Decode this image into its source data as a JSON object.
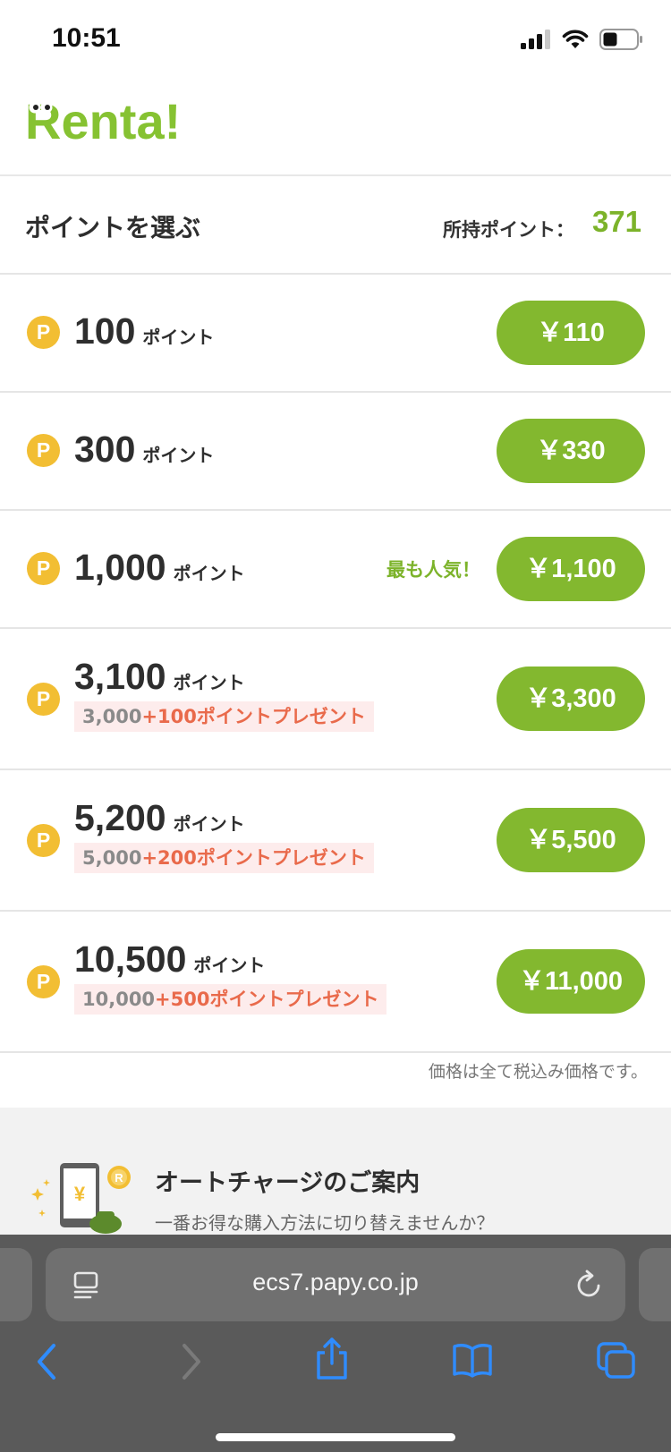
{
  "status_bar": {
    "time": "10:51"
  },
  "header": {
    "logo_text": "Renta!"
  },
  "points_section": {
    "title": "ポイントを選ぶ",
    "owned_label": "所持ポイント：",
    "owned_value": "371"
  },
  "point_options": [
    {
      "amount": "100",
      "unit": "ポイント",
      "price": "￥110",
      "popular": "",
      "bonus_base": "",
      "bonus_extra": ""
    },
    {
      "amount": "300",
      "unit": "ポイント",
      "price": "￥330",
      "popular": "",
      "bonus_base": "",
      "bonus_extra": ""
    },
    {
      "amount": "1,000",
      "unit": "ポイント",
      "price": "￥1,100",
      "popular": "最も人気！",
      "bonus_base": "",
      "bonus_extra": ""
    },
    {
      "amount": "3,100",
      "unit": "ポイント",
      "price": "￥3,300",
      "popular": "",
      "bonus_base": "3,000",
      "bonus_extra": "+100ポイントプレゼント"
    },
    {
      "amount": "5,200",
      "unit": "ポイント",
      "price": "￥5,500",
      "popular": "",
      "bonus_base": "5,000",
      "bonus_extra": "+200ポイントプレゼント"
    },
    {
      "amount": "10,500",
      "unit": "ポイント",
      "price": "￥11,000",
      "popular": "",
      "bonus_base": "10,000",
      "bonus_extra": "+500ポイントプレゼント"
    }
  ],
  "coin_letter": "P",
  "tax_note": "価格は全て税込み価格です。",
  "autocharge": {
    "title": "オートチャージのご案内",
    "description": "一番お得な購入方法に切り替えませんか？"
  },
  "browser": {
    "url": "ecs7.papy.co.jp"
  },
  "colors": {
    "brand_green": "#83b82f",
    "points_green": "#7cb32a",
    "coin_yellow": "#f2be33",
    "bonus_red": "#e96a4b",
    "bonus_bg": "#fdecec"
  }
}
